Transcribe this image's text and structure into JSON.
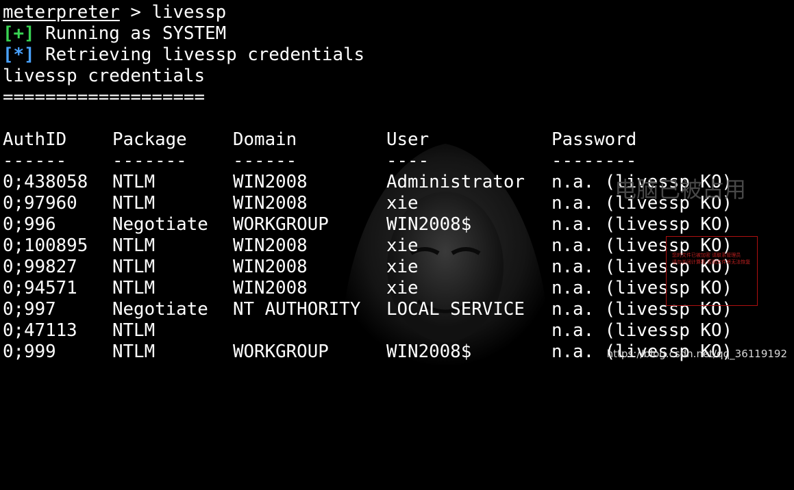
{
  "terminal": {
    "prompt": "meterpreter",
    "prompt_separator": " > ",
    "command": "livessp",
    "lines": [
      {
        "tag": "[+]",
        "text": " Running as SYSTEM"
      },
      {
        "tag": "[*]",
        "text": " Retrieving livessp credentials"
      }
    ],
    "section_title": "livessp credentials",
    "section_rule": "==================="
  },
  "table": {
    "headers": [
      "AuthID",
      "Package",
      "Domain",
      "User",
      "Password"
    ],
    "underlines": [
      "------",
      "-------",
      "------",
      "----",
      "--------"
    ],
    "rows": [
      [
        "0;438058",
        "NTLM",
        "WIN2008",
        "Administrator",
        "n.a. (livessp KO)"
      ],
      [
        "0;97960",
        "NTLM",
        "WIN2008",
        "xie",
        "n.a. (livessp KO)"
      ],
      [
        "0;996",
        "Negotiate",
        "WORKGROUP",
        "WIN2008$",
        "n.a. (livessp KO)"
      ],
      [
        "0;100895",
        "NTLM",
        "WIN2008",
        "xie",
        "n.a. (livessp KO)"
      ],
      [
        "0;99827",
        "NTLM",
        "WIN2008",
        "xie",
        "n.a. (livessp KO)"
      ],
      [
        "0;94571",
        "NTLM",
        "WIN2008",
        "xie",
        "n.a. (livessp KO)"
      ],
      [
        "0;997",
        "Negotiate",
        "NT AUTHORITY",
        "LOCAL SERVICE",
        "n.a. (livessp KO)"
      ],
      [
        "0;47113",
        "NTLM",
        "",
        "",
        "n.a. (livessp KO)"
      ],
      [
        "0;999",
        "NTLM",
        "WORKGROUP",
        "WIN2008$",
        "n.a. (livessp KO)"
      ]
    ]
  },
  "watermarks": {
    "overlay_text": "电脑已被占用",
    "redbox_lines": [
      "您的文件已被加密 请联系管理员",
      "请勿关闭计算机 否则文件将无法恢复"
    ],
    "url": "https://blog.csdn.net/qq_36119192"
  },
  "colors": {
    "background": "#000000",
    "foreground": "#ffffff",
    "success_tag": "#39d353",
    "info_tag": "#4aa3ff"
  }
}
